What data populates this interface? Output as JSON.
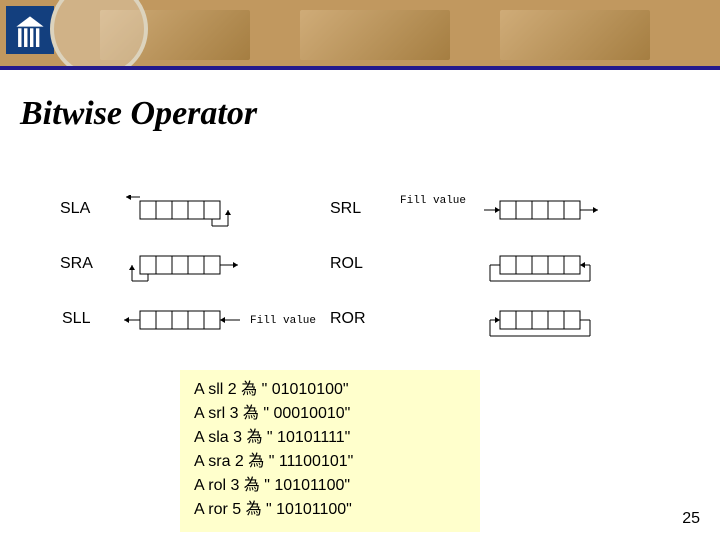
{
  "title": "Bitwise Operator",
  "labels": {
    "sla": "SLA",
    "sra": "SRA",
    "sll": "SLL",
    "srl": "SRL",
    "rol": "ROL",
    "ror": "ROR",
    "fill_value": "Fill value"
  },
  "examples": [
    "A sll 2 為 \" 01010100\"",
    "A srl 3 為 \" 00010010\"",
    "A sla 3 為 \" 10101111\"",
    "A sra 2 為 \" 11100101\"",
    "A rol 3 為 \" 10101100\"",
    "A ror 5 為 \" 10101100\""
  ],
  "page_number": "25"
}
